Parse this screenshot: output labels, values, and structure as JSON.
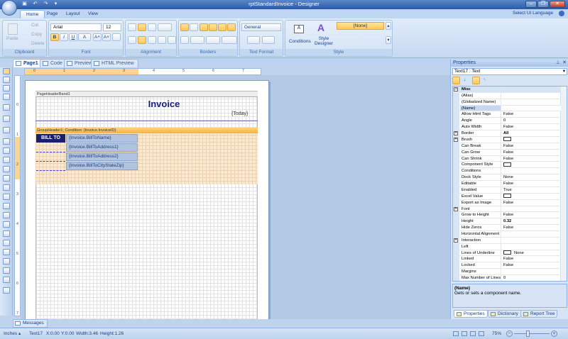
{
  "window": {
    "title": "rptStandardInvoice - Designer",
    "minimize": "–",
    "restore": "❐",
    "close": "✕"
  },
  "quick_access": {
    "save": "💾",
    "undo": "↶",
    "redo": "↷",
    "customize": "▾"
  },
  "ribbon": {
    "tabs": [
      "Home",
      "Page",
      "Layout",
      "View"
    ],
    "active_tab": "Home",
    "language": "Select UI Language",
    "clipboard": {
      "label": "Clipboard",
      "paste": "Paste",
      "cut": "Cut",
      "copy": "Copy",
      "delete": "Delete"
    },
    "font": {
      "label": "Font",
      "family": "Arial",
      "size": "12",
      "bold": "B",
      "italic": "I",
      "underline": "U",
      "color": "A",
      "grow": "A˄",
      "shrink": "A˅"
    },
    "alignment": {
      "label": "Alignment"
    },
    "borders": {
      "label": "Borders"
    },
    "text_format": {
      "label": "Text Format",
      "format": "General"
    },
    "style": {
      "label": "Style",
      "conditions": "Conditions",
      "style_designer": "Style Designer",
      "current": "[None]"
    }
  },
  "doc_tabs": [
    "Page1",
    "Code",
    "Preview",
    "HTML Preview"
  ],
  "active_doc_tab": "Page1",
  "ruler": {
    "h": [
      "0",
      "1",
      "2",
      "3",
      "4",
      "5",
      "6",
      "7"
    ],
    "v": [
      "0",
      "1",
      "2",
      "3",
      "4",
      "5",
      "6",
      "7"
    ]
  },
  "report": {
    "page_header_band": "PageHeaderBand1",
    "title": "Invoice",
    "today": "{Today}",
    "group_header": "GroupHeader1; Condition: {Invoice.InvoiceID}",
    "bill_to": "BILL TO",
    "fields": [
      "{Invoice.BillToName}",
      "{Invoice.BillToAddress1}",
      "{Invoice.BillToAddress2}",
      "{Invoice.BillToCityStateZip}"
    ]
  },
  "properties": {
    "title": "Properties",
    "pin": "📌",
    "close": "✕",
    "selected": "Text17 : Text",
    "rows": [
      {
        "name": "Misc",
        "value": "",
        "category": true,
        "expander": "−"
      },
      {
        "name": "(Alias)",
        "value": ""
      },
      {
        "name": "(Globalized Name)",
        "value": ""
      },
      {
        "name": "(Name)",
        "value": "",
        "selected": true
      },
      {
        "name": "Allow Html Tags",
        "value": "False"
      },
      {
        "name": "Angle",
        "value": "0"
      },
      {
        "name": "Auto Width",
        "value": "False"
      },
      {
        "name": "Border",
        "value": "All",
        "expander": "+",
        "bold": true
      },
      {
        "name": "Brush",
        "value": "",
        "expander": "+",
        "swatch": true
      },
      {
        "name": "Can Break",
        "value": "False"
      },
      {
        "name": "Can Grow",
        "value": "False"
      },
      {
        "name": "Can Shrink",
        "value": "False"
      },
      {
        "name": "Component Style",
        "value": "",
        "swatch": true
      },
      {
        "name": "Conditions",
        "value": ""
      },
      {
        "name": "Dock Style",
        "value": "None"
      },
      {
        "name": "Editable",
        "value": "False"
      },
      {
        "name": "Enabled",
        "value": "True"
      },
      {
        "name": "Excel Value",
        "value": "",
        "swatch": true
      },
      {
        "name": "Export as Image",
        "value": "False"
      },
      {
        "name": "Font",
        "value": "",
        "expander": "+"
      },
      {
        "name": "Grow to Height",
        "value": "False"
      },
      {
        "name": "Height",
        "value": "0.32",
        "bold": true
      },
      {
        "name": "Hide Zeros",
        "value": "False"
      },
      {
        "name": "Horizontal Alignment",
        "value": ""
      },
      {
        "name": "Interaction",
        "value": "",
        "expander": "+"
      },
      {
        "name": "Left",
        "value": ""
      },
      {
        "name": "Lines of Underline",
        "value": "None",
        "swatch": true
      },
      {
        "name": "Linked",
        "value": "False"
      },
      {
        "name": "Locked",
        "value": "False"
      },
      {
        "name": "Margins",
        "value": ""
      },
      {
        "name": "Max Number of Lines",
        "value": "0"
      }
    ],
    "desc_title": "(Name)",
    "desc_text": "Gets or sets a component name.",
    "tabs": [
      "Properties",
      "Dictionary",
      "Report Tree"
    ]
  },
  "messages_tab": "Messages",
  "status": {
    "units": "Inches",
    "units_arrow": "▴",
    "component": "Text17",
    "x": "X:0.00",
    "y": "Y:0.00",
    "width": "Width:3.46",
    "height": "Height:1.26",
    "zoom": "75%",
    "zoom_out": "−",
    "zoom_in": "+"
  },
  "zoom_level_percent": 75
}
